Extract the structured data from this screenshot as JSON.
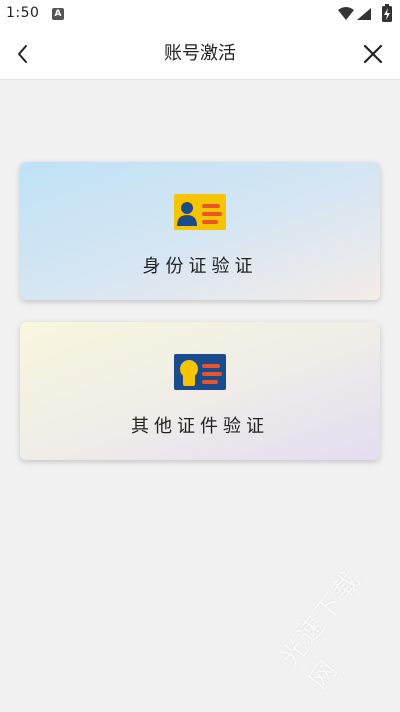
{
  "status_bar": {
    "time": "1:50",
    "app_icon_letter": "A",
    "icons": [
      "wifi-icon",
      "signal-icon",
      "battery-icon"
    ]
  },
  "header": {
    "title": "账号激活",
    "back_icon": "chevron-left-icon",
    "close_icon": "close-icon"
  },
  "options": [
    {
      "label": "身份证验证",
      "icon": "id-card-icon",
      "card_color": "#f6c400"
    },
    {
      "label": "其他证件验证",
      "icon": "document-card-icon",
      "card_color": "#1a4b8c"
    }
  ],
  "colors": {
    "accent_orange": "#e8552b",
    "person_blue": "#1a4b8c",
    "background": "#f1f1f1"
  },
  "watermark": "光速下载网"
}
